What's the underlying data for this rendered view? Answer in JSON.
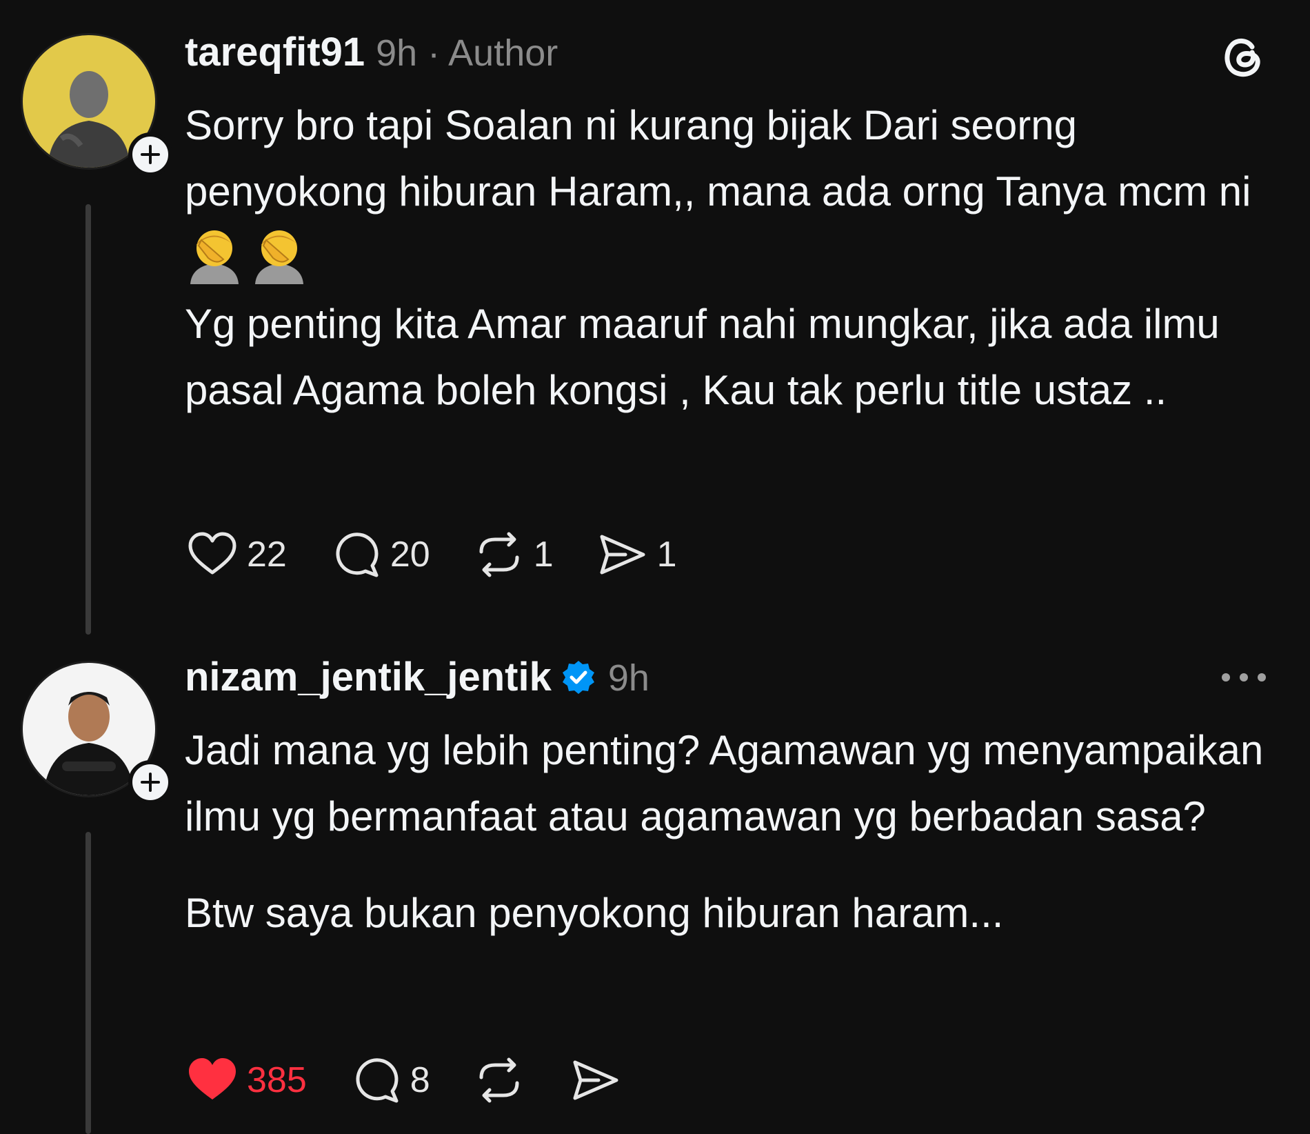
{
  "posts": [
    {
      "username": "tareqfit91",
      "meta": "9h · Author",
      "paragraphs": [
        "Sorry bro tapi Soalan ni kurang bijak Dari seorng penyokong hiburan Haram,, mana ada orng Tanya mcm ni",
        "Yg penting kita Amar maaruf nahi mungkar, jika ada ilmu pasal Agama boleh kongsi , Kau tak perlu title ustaz .."
      ],
      "emoji": "facepalm-emoji",
      "likes": "22",
      "replies": "20",
      "reposts": "1",
      "shares": "1",
      "avatar_bg": "#e2c94a",
      "corner_icon": "threads-logo-icon"
    },
    {
      "username": "nizam_jentik_jentik",
      "meta": "9h",
      "verified": true,
      "paragraphs": [
        "Jadi mana yg lebih penting? Agamawan yg menyampaikan ilmu yg bermanfaat atau agamawan yg berbadan sasa?",
        "Btw saya bukan penyokong hiburan haram..."
      ],
      "likes": "385",
      "liked": true,
      "replies": "8",
      "avatar_bg": "#f4f4f4",
      "corner_icon": "more-options-icon"
    }
  ],
  "colors": {
    "background": "#0f0f0f",
    "text": "#f3f5f7",
    "muted": "#8b8b8b",
    "like_red": "#ff3040",
    "verified_blue": "#0095f6"
  }
}
